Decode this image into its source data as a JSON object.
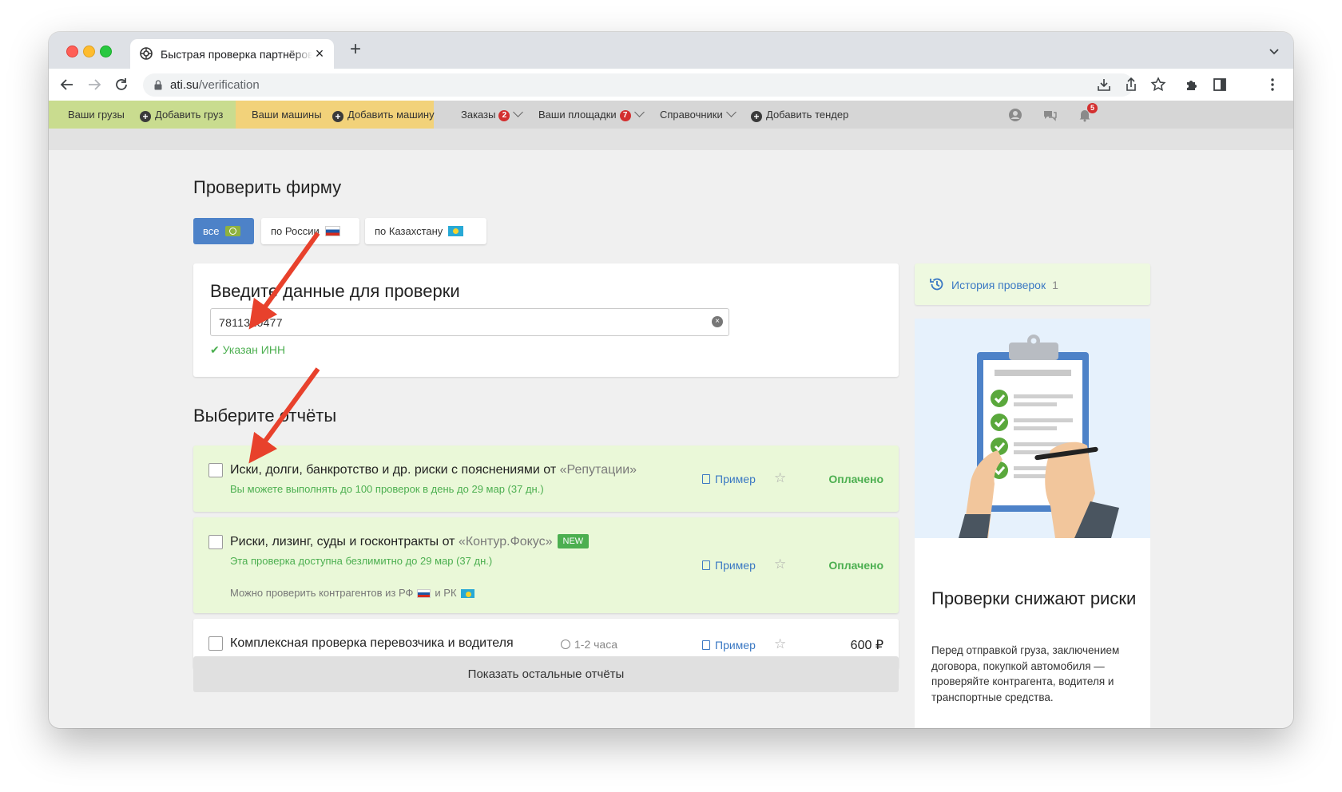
{
  "browser": {
    "tab_title": "Быстрая проверка партнёров",
    "tab_close": "×",
    "new_tab": "+",
    "url_host": "ati.su",
    "url_path": "/verification"
  },
  "menu": {
    "your_cargo": "Ваши грузы",
    "add_cargo": "Добавить груз",
    "your_trucks": "Ваши машины",
    "add_truck": "Добавить машину",
    "orders": "Заказы",
    "orders_badge": "2",
    "your_platforms": "Ваши площадки",
    "platforms_badge": "7",
    "directories": "Справочники",
    "add_tender": "Добавить тендер",
    "notifications_badge": "5",
    "plus": "+"
  },
  "page": {
    "title": "Проверить фирму",
    "filters": {
      "all": "все",
      "russia": "по России",
      "kazakhstan": "по Казахстану"
    },
    "input_heading": "Введите данные для проверки",
    "inn_value": "7811320477",
    "inn_status": "Указан ИНН",
    "clear": "×",
    "reports_title": "Выберите отчёты",
    "reports": [
      {
        "title": "Иски, долги, банкротство и др. риски с пояснениями от",
        "source": "«Репутации»",
        "subtitle": "Вы можете выполнять до 100 проверок в день до 29 мар (37 дн.)",
        "example": "Пример",
        "status": "Оплачено"
      },
      {
        "title": "Риски, лизинг, суды и госконтракты от",
        "source": "«Контур.Фокус»",
        "badge": "NEW",
        "subtitle": "Эта проверка доступна безлимитно до 29 мар (37 дн.)",
        "note_prefix": "Можно проверить контрагентов из РФ",
        "note_and": "и РК",
        "example": "Пример",
        "status": "Оплачено"
      },
      {
        "title": "Комплексная проверка перевозчика и водителя",
        "duration": "1-2 часа",
        "example": "Пример",
        "price": "600 ₽"
      }
    ],
    "show_more": "Показать остальные отчёты",
    "star": "☆",
    "check": "✔"
  },
  "sidebar": {
    "history_label": "История проверок",
    "history_count": "1",
    "promo_title": "Проверки снижают риски",
    "promo_text": "Перед отправкой груза, заключением договора, покупкой автомобиля — проверяйте контрагента, водителя и транспортные средства."
  },
  "colors": {
    "accent_blue": "#4d82c8",
    "success_green": "#4caf50",
    "badge_red": "#d32f2f",
    "annotation_arrow": "#e8412c"
  }
}
